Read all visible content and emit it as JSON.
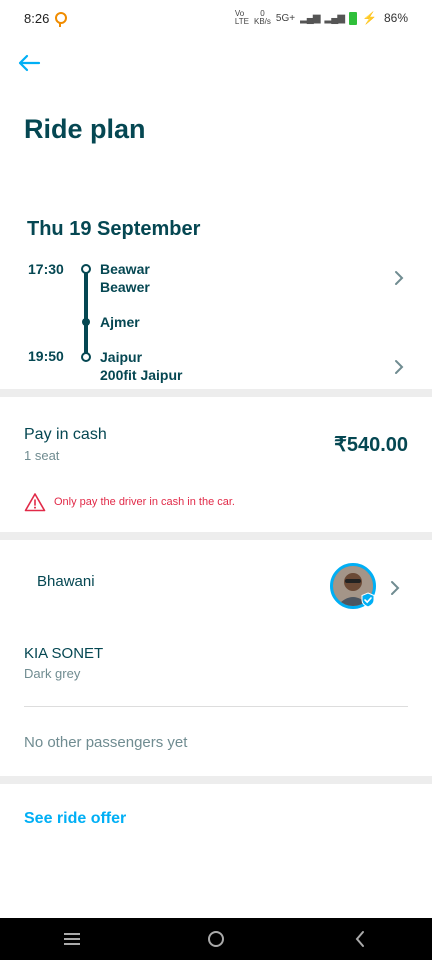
{
  "status_bar": {
    "time": "8:26",
    "net_speed_top": "0",
    "net_speed_unit": "KB/s",
    "network_type": "5G+",
    "battery_percent": "86%"
  },
  "header": {
    "title": "Ride plan",
    "back_icon": "arrow-left-icon"
  },
  "trip": {
    "date": "Thu 19 September",
    "departure_time": "17:30",
    "arrival_time": "19:50",
    "origin_city": "Beawar",
    "origin_place": "Beawer",
    "stopover": "Ajmer",
    "destination_city": "Jaipur",
    "destination_place": "200fit Jaipur"
  },
  "payment": {
    "title": "Pay in cash",
    "seats": "1 seat",
    "price": "₹540.00",
    "warning": "Only pay the driver in cash in the car."
  },
  "driver": {
    "name": "Bhawani"
  },
  "car": {
    "model": "KIA SONET",
    "color": "Dark grey"
  },
  "passengers": {
    "empty_text": "No other passengers yet"
  },
  "actions": {
    "see_offer": "See ride offer"
  },
  "colors": {
    "primary_text": "#054752",
    "secondary_text": "#708c91",
    "accent": "#00aff5",
    "warning": "#e12a48"
  }
}
